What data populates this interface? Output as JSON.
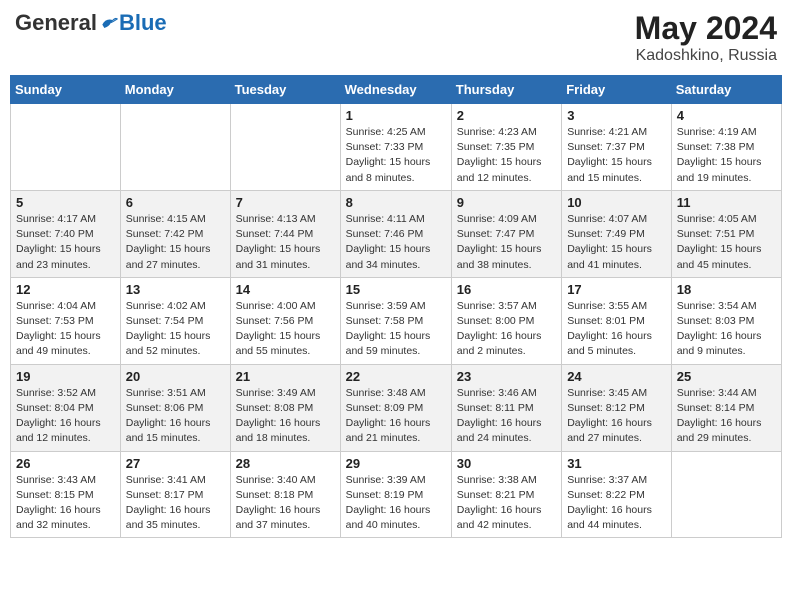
{
  "header": {
    "logo_general": "General",
    "logo_blue": "Blue",
    "month_year": "May 2024",
    "location": "Kadoshkino, Russia"
  },
  "days_of_week": [
    "Sunday",
    "Monday",
    "Tuesday",
    "Wednesday",
    "Thursday",
    "Friday",
    "Saturday"
  ],
  "weeks": [
    [
      {
        "num": "",
        "info": ""
      },
      {
        "num": "",
        "info": ""
      },
      {
        "num": "",
        "info": ""
      },
      {
        "num": "1",
        "info": "Sunrise: 4:25 AM\nSunset: 7:33 PM\nDaylight: 15 hours\nand 8 minutes."
      },
      {
        "num": "2",
        "info": "Sunrise: 4:23 AM\nSunset: 7:35 PM\nDaylight: 15 hours\nand 12 minutes."
      },
      {
        "num": "3",
        "info": "Sunrise: 4:21 AM\nSunset: 7:37 PM\nDaylight: 15 hours\nand 15 minutes."
      },
      {
        "num": "4",
        "info": "Sunrise: 4:19 AM\nSunset: 7:38 PM\nDaylight: 15 hours\nand 19 minutes."
      }
    ],
    [
      {
        "num": "5",
        "info": "Sunrise: 4:17 AM\nSunset: 7:40 PM\nDaylight: 15 hours\nand 23 minutes."
      },
      {
        "num": "6",
        "info": "Sunrise: 4:15 AM\nSunset: 7:42 PM\nDaylight: 15 hours\nand 27 minutes."
      },
      {
        "num": "7",
        "info": "Sunrise: 4:13 AM\nSunset: 7:44 PM\nDaylight: 15 hours\nand 31 minutes."
      },
      {
        "num": "8",
        "info": "Sunrise: 4:11 AM\nSunset: 7:46 PM\nDaylight: 15 hours\nand 34 minutes."
      },
      {
        "num": "9",
        "info": "Sunrise: 4:09 AM\nSunset: 7:47 PM\nDaylight: 15 hours\nand 38 minutes."
      },
      {
        "num": "10",
        "info": "Sunrise: 4:07 AM\nSunset: 7:49 PM\nDaylight: 15 hours\nand 41 minutes."
      },
      {
        "num": "11",
        "info": "Sunrise: 4:05 AM\nSunset: 7:51 PM\nDaylight: 15 hours\nand 45 minutes."
      }
    ],
    [
      {
        "num": "12",
        "info": "Sunrise: 4:04 AM\nSunset: 7:53 PM\nDaylight: 15 hours\nand 49 minutes."
      },
      {
        "num": "13",
        "info": "Sunrise: 4:02 AM\nSunset: 7:54 PM\nDaylight: 15 hours\nand 52 minutes."
      },
      {
        "num": "14",
        "info": "Sunrise: 4:00 AM\nSunset: 7:56 PM\nDaylight: 15 hours\nand 55 minutes."
      },
      {
        "num": "15",
        "info": "Sunrise: 3:59 AM\nSunset: 7:58 PM\nDaylight: 15 hours\nand 59 minutes."
      },
      {
        "num": "16",
        "info": "Sunrise: 3:57 AM\nSunset: 8:00 PM\nDaylight: 16 hours\nand 2 minutes."
      },
      {
        "num": "17",
        "info": "Sunrise: 3:55 AM\nSunset: 8:01 PM\nDaylight: 16 hours\nand 5 minutes."
      },
      {
        "num": "18",
        "info": "Sunrise: 3:54 AM\nSunset: 8:03 PM\nDaylight: 16 hours\nand 9 minutes."
      }
    ],
    [
      {
        "num": "19",
        "info": "Sunrise: 3:52 AM\nSunset: 8:04 PM\nDaylight: 16 hours\nand 12 minutes."
      },
      {
        "num": "20",
        "info": "Sunrise: 3:51 AM\nSunset: 8:06 PM\nDaylight: 16 hours\nand 15 minutes."
      },
      {
        "num": "21",
        "info": "Sunrise: 3:49 AM\nSunset: 8:08 PM\nDaylight: 16 hours\nand 18 minutes."
      },
      {
        "num": "22",
        "info": "Sunrise: 3:48 AM\nSunset: 8:09 PM\nDaylight: 16 hours\nand 21 minutes."
      },
      {
        "num": "23",
        "info": "Sunrise: 3:46 AM\nSunset: 8:11 PM\nDaylight: 16 hours\nand 24 minutes."
      },
      {
        "num": "24",
        "info": "Sunrise: 3:45 AM\nSunset: 8:12 PM\nDaylight: 16 hours\nand 27 minutes."
      },
      {
        "num": "25",
        "info": "Sunrise: 3:44 AM\nSunset: 8:14 PM\nDaylight: 16 hours\nand 29 minutes."
      }
    ],
    [
      {
        "num": "26",
        "info": "Sunrise: 3:43 AM\nSunset: 8:15 PM\nDaylight: 16 hours\nand 32 minutes."
      },
      {
        "num": "27",
        "info": "Sunrise: 3:41 AM\nSunset: 8:17 PM\nDaylight: 16 hours\nand 35 minutes."
      },
      {
        "num": "28",
        "info": "Sunrise: 3:40 AM\nSunset: 8:18 PM\nDaylight: 16 hours\nand 37 minutes."
      },
      {
        "num": "29",
        "info": "Sunrise: 3:39 AM\nSunset: 8:19 PM\nDaylight: 16 hours\nand 40 minutes."
      },
      {
        "num": "30",
        "info": "Sunrise: 3:38 AM\nSunset: 8:21 PM\nDaylight: 16 hours\nand 42 minutes."
      },
      {
        "num": "31",
        "info": "Sunrise: 3:37 AM\nSunset: 8:22 PM\nDaylight: 16 hours\nand 44 minutes."
      },
      {
        "num": "",
        "info": ""
      }
    ]
  ]
}
